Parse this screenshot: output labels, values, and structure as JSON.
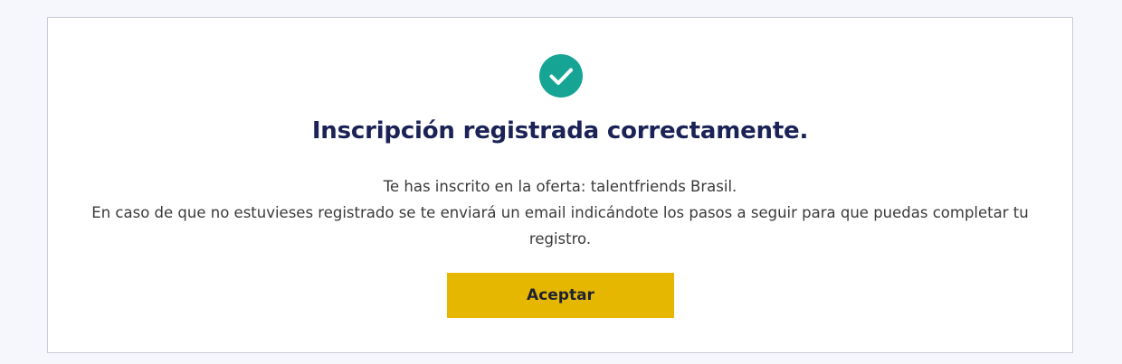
{
  "colors": {
    "page_background": "#f5f7fc",
    "card_background": "#ffffff",
    "success": "#16a595",
    "title": "#1a2256",
    "body_text": "#3a3a3a",
    "button_background": "#e6b700",
    "button_text": "#1f2233"
  },
  "icons": {
    "status": "check-circle-icon"
  },
  "dialog": {
    "title": "Inscripción registrada correctamente.",
    "line1": "Te has inscrito en la oferta: talentfriends Brasil.",
    "line2": "En caso de que no estuvieses registrado se te enviará un email indicándote los pasos a seguir para que puedas completar tu registro.",
    "accept_label": "Aceptar"
  }
}
